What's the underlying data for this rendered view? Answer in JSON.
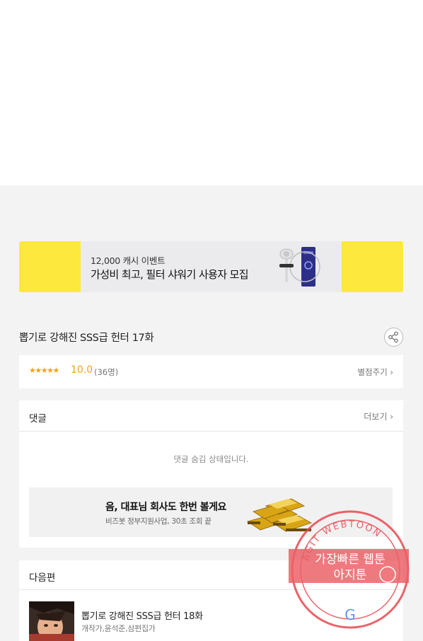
{
  "banner": {
    "subtitle": "12,000 캐시 이벤트",
    "title": "가성비 최고, 필터 샤워기 사용자 모집",
    "icon": "shower-filter-image"
  },
  "episode": {
    "title": "뽑기로 강해진 SSS급 헌터 17화",
    "share_icon": "share-icon"
  },
  "rating": {
    "stars": "★★★★★",
    "score": "10.0",
    "count": "(36명)",
    "rate_label": "별점주기 ›"
  },
  "comments": {
    "header": "댓글",
    "more_label": "더보기 ›",
    "hidden_message": "댓글 숨김 상태입니다.",
    "ad": {
      "title": "음, 대표님 회사도 한번 볼게요",
      "subtitle": "비즈봇 정부지원사업, 30초 조회 끝",
      "image": "gold-money-image"
    }
  },
  "next": {
    "header": "다음편",
    "title": "뽑기로 강해진 SSS급 헌터 18화",
    "authors": "개작가,윤석준,삼편집가"
  },
  "watermark": {
    "ring_text": "AGIT WEBTOON",
    "line1": "가장빠른 웹툰",
    "line2": "아지툰",
    "color": "#e8484f"
  },
  "colors": {
    "banner_yellow": "#fde83d",
    "rating_orange": "#f2a413",
    "page_bg": "#f3f3f4"
  }
}
